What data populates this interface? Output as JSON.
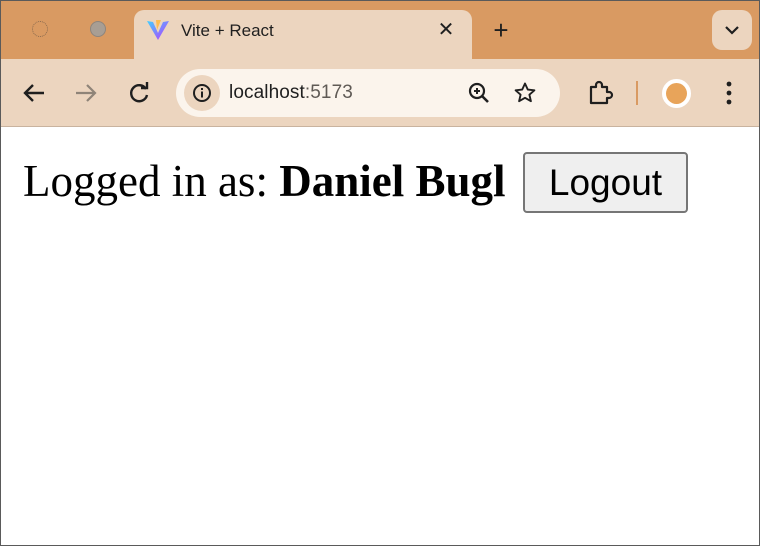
{
  "browser": {
    "tab": {
      "title": "Vite + React",
      "favicon": "vite-logo-icon"
    },
    "colors": {
      "frame": "#d99a62",
      "toolbar": "#ecd5bf",
      "omnibox": "#fbf4ec",
      "accent": "#e8a45a"
    }
  },
  "toolbar": {
    "url": {
      "host": "localhost",
      "port": ":5173"
    }
  },
  "page": {
    "prefix": "Logged in as: ",
    "username": "Daniel Bugl",
    "logout_label": "Logout"
  }
}
